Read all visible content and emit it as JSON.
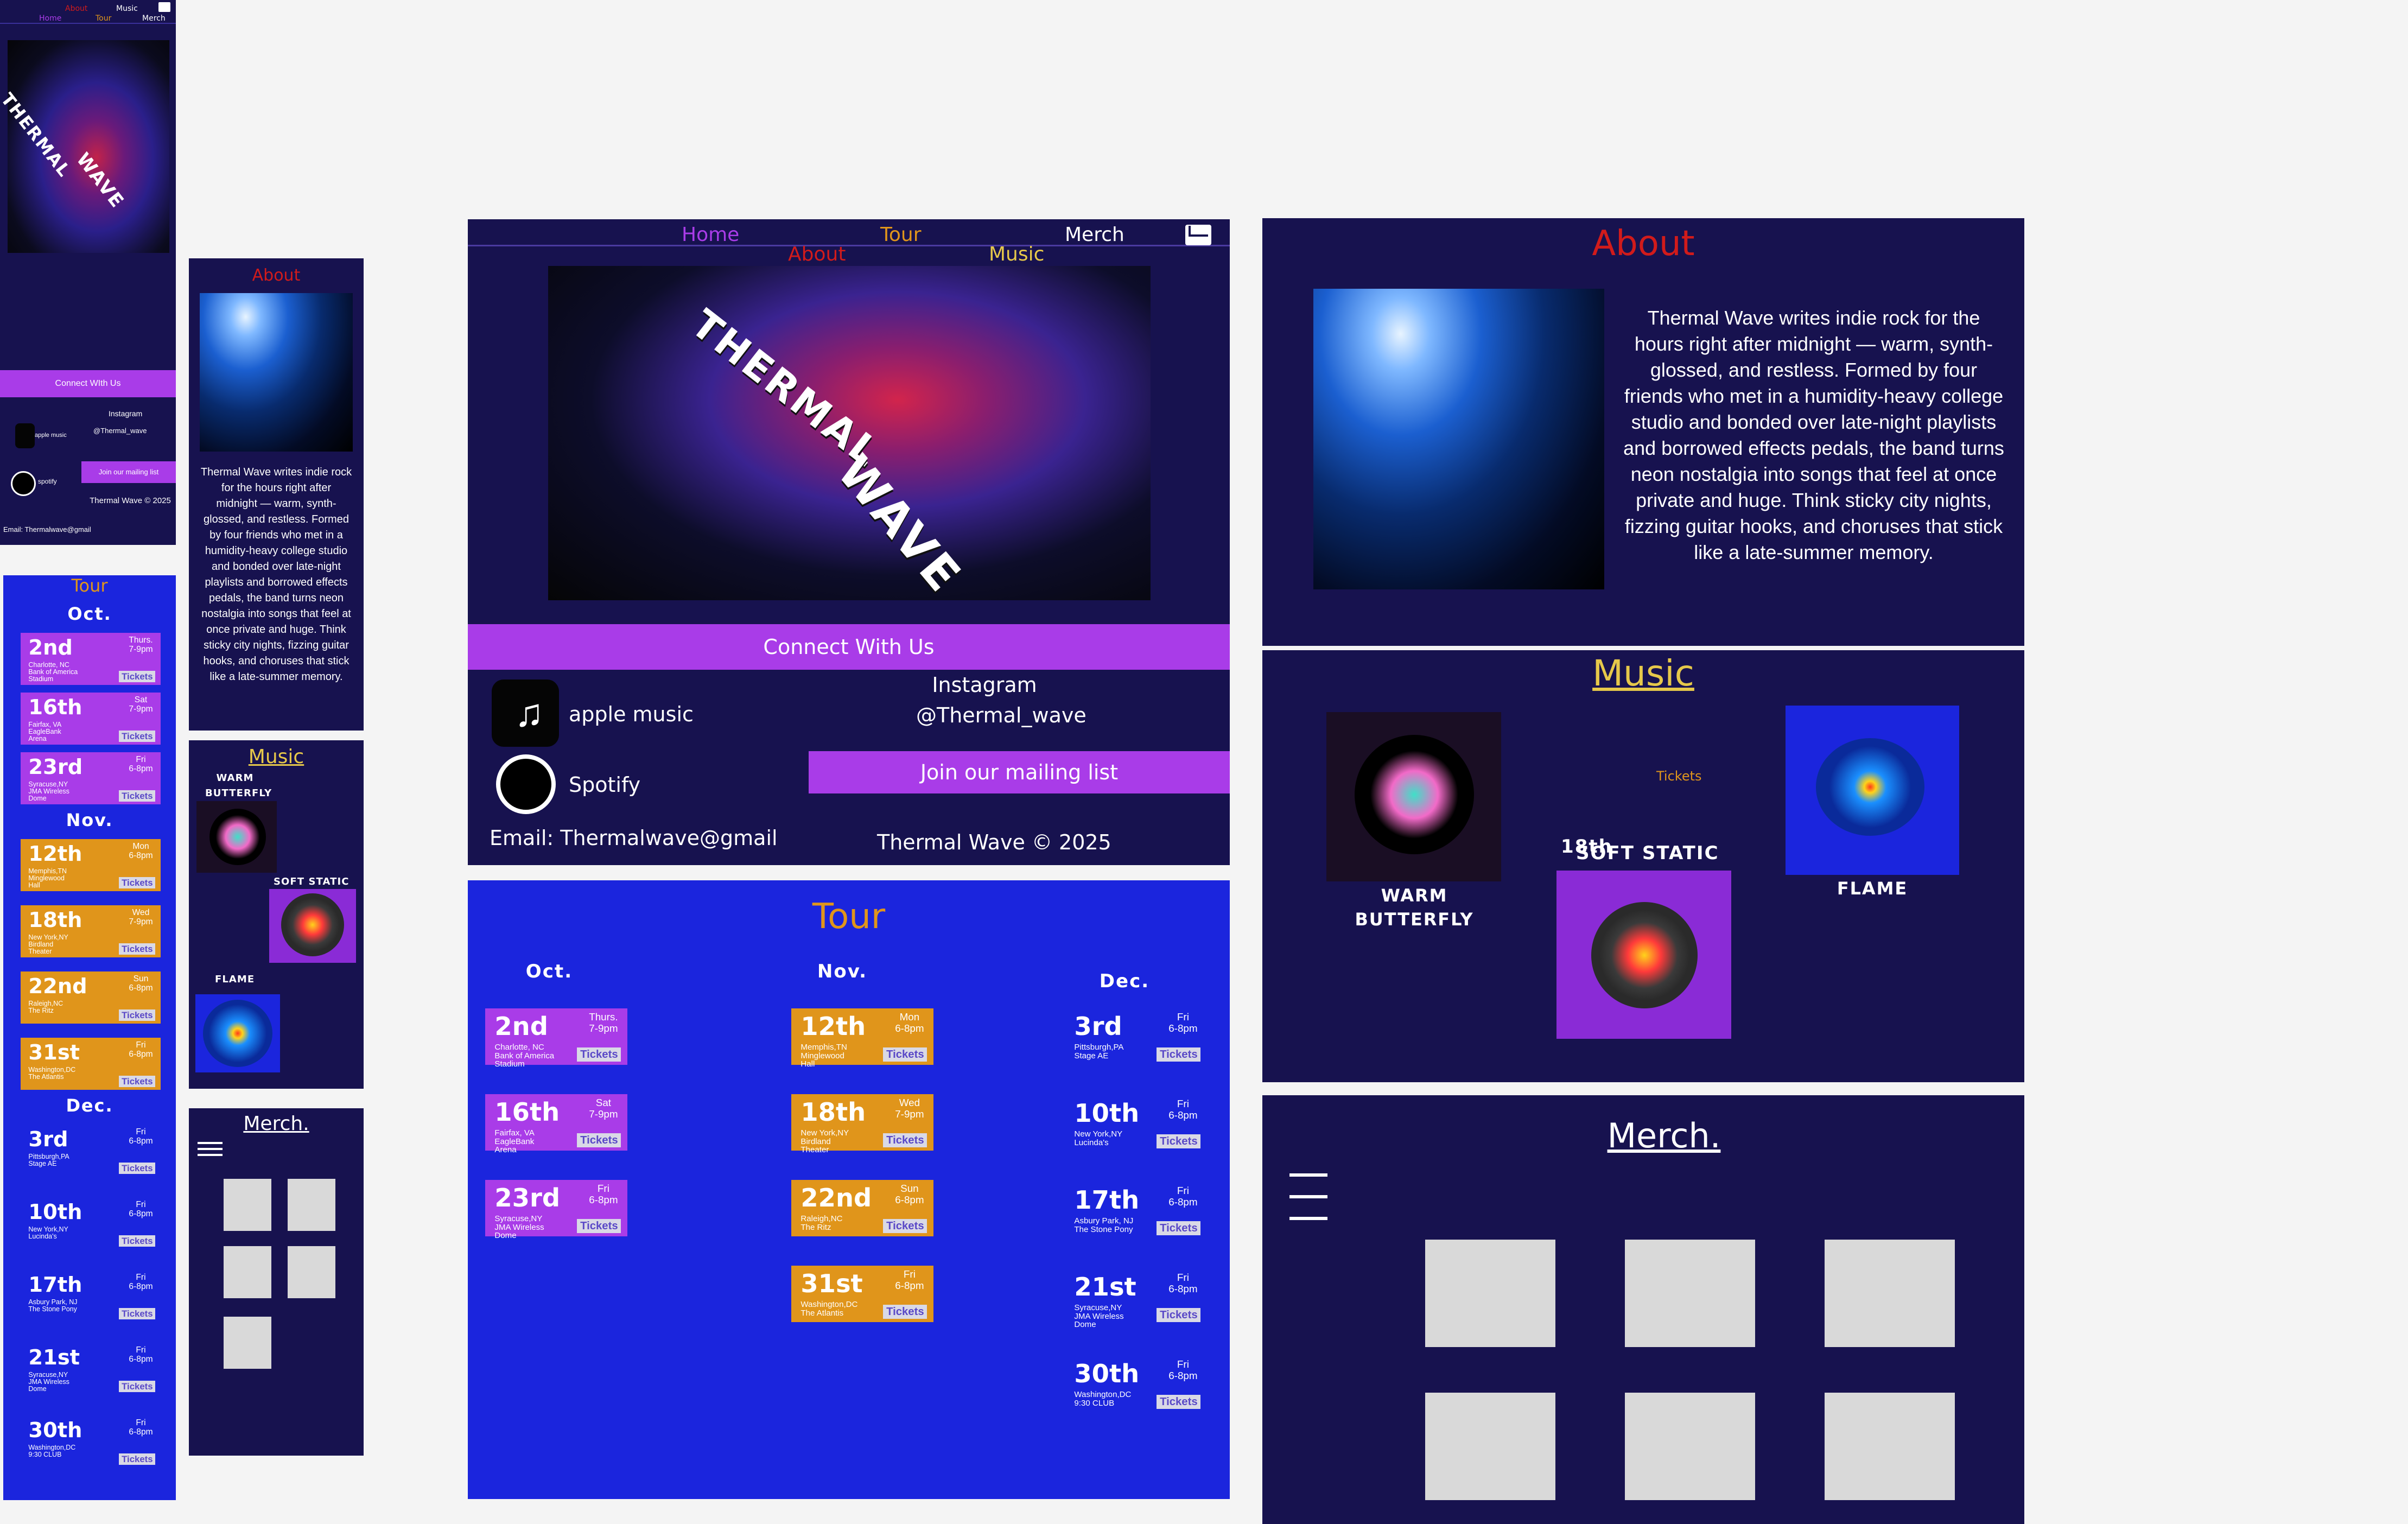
{
  "band": {
    "name_top": "Thermal",
    "name_bottom": "Wave"
  },
  "nav": {
    "home": "Home",
    "tour": "Tour",
    "merch": "Merch",
    "about": "About",
    "music": "Music"
  },
  "connect": {
    "title": "Connect With Us",
    "mobile_title": "Connect WIth Us",
    "apple": "apple music",
    "spotify": "Spotify",
    "spotify_mobile": "spotify",
    "instagram": "Instagram",
    "handle": "@Thermal_wave",
    "mailing": "Join our mailing list",
    "email": "Email: Thermalwave@gmail",
    "copyright": "Thermal Wave © 2025",
    "copyright_mobile": "Thermal Wave © 2025"
  },
  "about": {
    "title": "About",
    "text": "Thermal Wave writes indie rock for the hours right after midnight — warm, synth-glossed, and restless. Formed by four friends who met in a humidity-heavy college studio and bonded over late-night playlists and borrowed effects pedals, the band turns neon nostalgia into songs that feel at once private and huge. Think sticky city nights, fizzing guitar hooks, and choruses that stick like a late-summer memory."
  },
  "music": {
    "title": "Music",
    "tickets": "Tickets",
    "overlap": "18th",
    "albums": [
      {
        "name": "Warm Butterfly"
      },
      {
        "name": "Soft Static"
      },
      {
        "name": "Flame"
      }
    ]
  },
  "merch": {
    "title": "Merch."
  },
  "tour": {
    "title": "Tour",
    "tickets": "Tickets",
    "months": [
      "Oct.",
      "Nov.",
      "Dec."
    ],
    "oct": [
      {
        "day": "2nd",
        "dt": "Thurs.\n7-9pm",
        "venue": "Charlotte, NC\nBank of America\nStadium"
      },
      {
        "day": "16th",
        "dt": "Sat\n7-9pm",
        "venue": "Fairfax, VA\nEagleBank\nArena"
      },
      {
        "day": "23rd",
        "dt": "Fri\n6-8pm",
        "venue": "Syracuse,NY\nJMA Wireless\nDome"
      }
    ],
    "nov": [
      {
        "day": "12th",
        "dt": "Mon\n6-8pm",
        "venue": "Memphis,TN\nMinglewood\nHall"
      },
      {
        "day": "18th",
        "dt": "Wed\n7-9pm",
        "venue": "New York,NY\nBirdland\nTheater"
      },
      {
        "day": "22nd",
        "dt": "Sun\n6-8pm",
        "venue": "Raleigh,NC\nThe Ritz"
      },
      {
        "day": "31st",
        "dt": "Fri\n6-8pm",
        "venue": "Washington,DC\nThe Atlantis"
      }
    ],
    "dec": [
      {
        "day": "3rd",
        "dt": "Fri\n6-8pm",
        "venue": "Pittsburgh,PA\nStage AE"
      },
      {
        "day": "10th",
        "dt": "Fri\n6-8pm",
        "venue": "New York,NY\nLucinda's"
      },
      {
        "day": "17th",
        "dt": "Fri\n6-8pm",
        "venue": "Asbury Park, NJ\nThe Stone Pony"
      },
      {
        "day": "21st",
        "dt": "Fri\n6-8pm",
        "venue": "Syracuse,NY\nJMA Wireless\nDome"
      },
      {
        "day": "30th",
        "dt": "Fri\n6-8pm",
        "venue": "Washington,DC\n9:30 CLUB"
      }
    ]
  },
  "colors": {
    "dark": "#17124f",
    "blue": "#1b25dd",
    "purple": "#a93ce8",
    "orange": "#e0951b",
    "red": "#d11b1b",
    "yellow": "#e6c84a"
  }
}
